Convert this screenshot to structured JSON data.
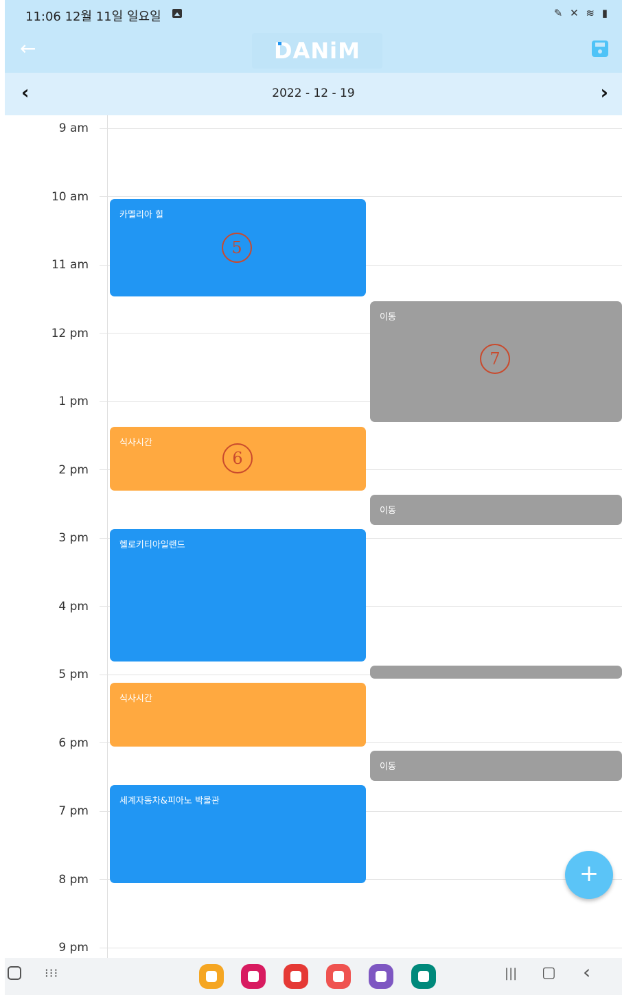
{
  "status_bar": {
    "time_date": "11:06  12월 11일 일요일",
    "system_icons": "✎ ✕ ≋ ▮"
  },
  "app_bar": {
    "back_icon": "←",
    "logo_text": "DANiM",
    "save_icon": "save-icon"
  },
  "date_bar": {
    "prev_icon": "‹",
    "date": "2022 - 12 - 19",
    "next_icon": "›"
  },
  "hours": [
    "9 am",
    "10 am",
    "11 am",
    "12 pm",
    "1 pm",
    "2 pm",
    "3 pm",
    "4 pm",
    "5 pm",
    "6 pm",
    "7 pm",
    "8 pm",
    "9 pm"
  ],
  "events": {
    "camellia": "카멜리아 힐",
    "move1": "이동",
    "meal1": "식사시간",
    "move2": "이동",
    "hellokitty": "헬로키티아일랜드",
    "move3": "",
    "meal2": "식사시간",
    "move4": "이동",
    "museum": "세계자동차&피아노 박물관"
  },
  "annotations": {
    "a5": "5",
    "a6": "6",
    "a7": "7"
  },
  "fab": {
    "label": "+"
  },
  "nav": {
    "recent": "|||",
    "home": "▢",
    "back": "‹",
    "apps_grid": "⁝⁝⁝"
  },
  "colors": {
    "header_bg": "#c5e7fa",
    "date_bar_bg": "#dbeffc",
    "event_blue": "#2196f3",
    "event_orange": "#ffa940",
    "event_gray": "#9e9e9e",
    "fab": "#5bc4f7",
    "annotation": "#c94a2d"
  }
}
